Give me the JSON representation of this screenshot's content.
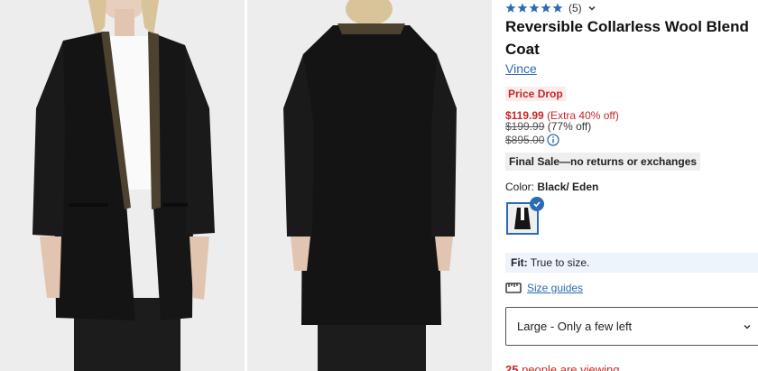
{
  "product": {
    "rating_count": "(5)",
    "title": "Reversible Collarless Wool Blend Coat",
    "brand": "Vince",
    "badge": "Price Drop",
    "sale_price": "$119.99",
    "extra_off": "(Extra 40% off)",
    "original_price": "$199.99",
    "original_pct": "(77% off)",
    "compare_price": "$895.00",
    "final_sale": "Final Sale—no returns or exchanges",
    "color_label": "Color:",
    "color_value": "Black/ Eden",
    "fit_label": "Fit:",
    "fit_value": "True to size.",
    "size_guides": "Size guides",
    "size_selected": "Large - Only a few left",
    "viewing_count": "25",
    "viewing_text": "people are viewing"
  },
  "colors": {
    "accent": "#2b6cb0",
    "sale": "#c62828"
  },
  "icons": {
    "star": "star-icon",
    "chevron": "chevron-down-icon",
    "info": "info-icon",
    "ruler": "ruler-icon",
    "check": "check-icon"
  }
}
